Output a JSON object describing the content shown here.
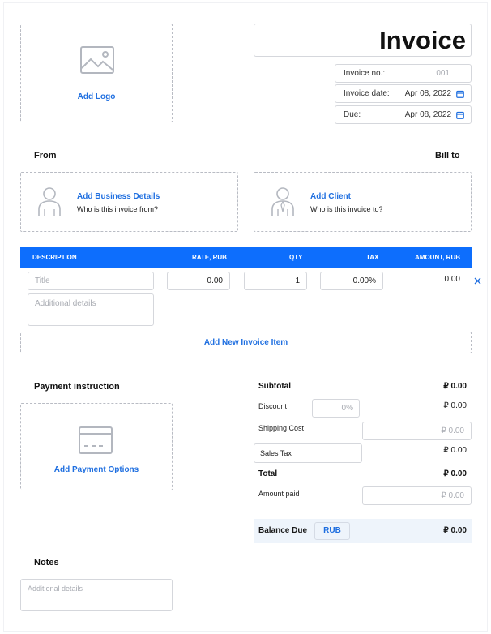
{
  "logo": {
    "label": "Add Logo"
  },
  "header": {
    "title": "Invoice",
    "invoice_no_label": "Invoice no.:",
    "invoice_no_placeholder": "001",
    "invoice_date_label": "Invoice date:",
    "invoice_date": "Apr 08, 2022",
    "due_label": "Due:",
    "due_date": "Apr 08, 2022"
  },
  "from": {
    "heading": "From",
    "title": "Add Business Details",
    "subtitle": "Who is this invoice from?"
  },
  "bill_to": {
    "heading": "Bill to",
    "title": "Add Client",
    "subtitle": "Who is this invoice to?"
  },
  "table": {
    "columns": [
      "DESCRIPTION",
      "RATE, RUB",
      "QTY",
      "TAX",
      "AMOUNT, RUB"
    ],
    "row": {
      "title_placeholder": "Title",
      "details_placeholder": "Additional details",
      "rate": "0.00",
      "qty": "1",
      "tax_placeholder": "0.00%",
      "amount": "0.00"
    },
    "add_item_label": "Add New Invoice Item"
  },
  "payment": {
    "heading": "Payment instruction",
    "label": "Add Payment Options"
  },
  "totals": {
    "subtotal_label": "Subtotal",
    "subtotal": "₽ 0.00",
    "discount_label": "Discount",
    "discount_placeholder": "0%",
    "discount": "₽ 0.00",
    "shipping_label": "Shipping Cost",
    "shipping_placeholder": "₽ 0.00",
    "sales_tax_label": "Sales Tax",
    "sales_tax": "₽ 0.00",
    "total_label": "Total",
    "total": "₽ 0.00",
    "amount_paid_label": "Amount paid",
    "amount_paid_placeholder": "₽ 0.00",
    "balance_label": "Balance Due",
    "currency": "RUB",
    "balance": "₽ 0.00"
  },
  "notes": {
    "heading": "Notes",
    "placeholder": "Additional details"
  },
  "colors": {
    "accent": "#1f6fe0",
    "table_header": "#0d6efd",
    "balance_bg": "#eef4fb"
  }
}
